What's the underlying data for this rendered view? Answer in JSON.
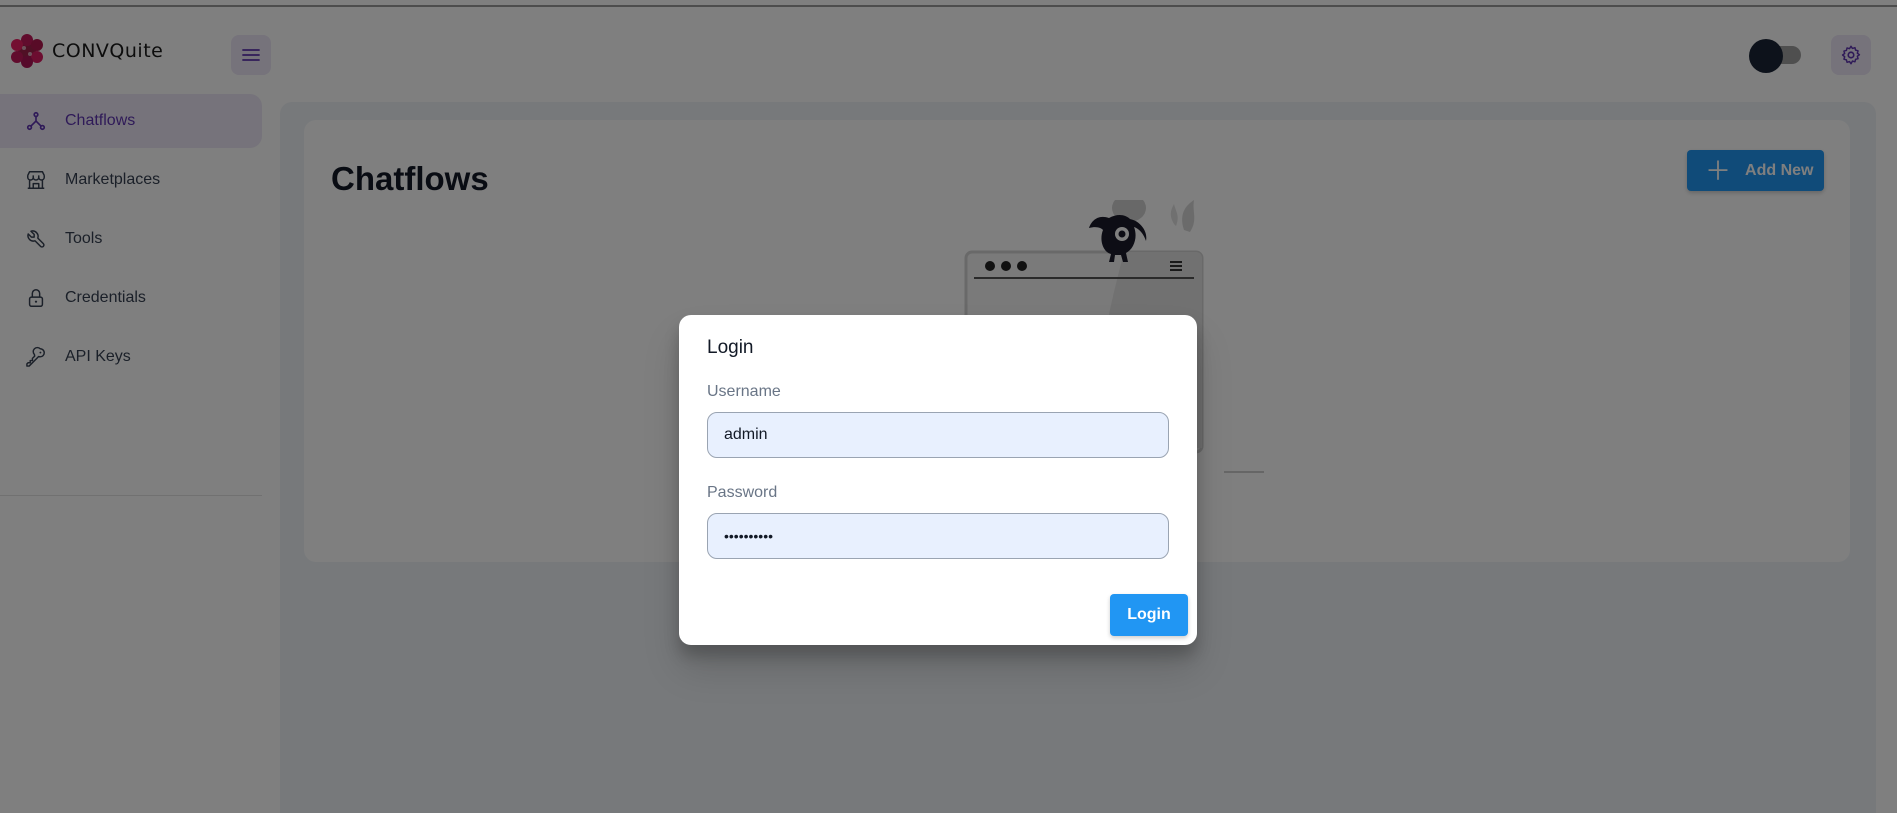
{
  "app": {
    "logo_text": "CONVQuite"
  },
  "sidebar": {
    "items": [
      {
        "label": "Chatflows",
        "icon": "hierarchy-icon",
        "active": true
      },
      {
        "label": "Marketplaces",
        "icon": "building-store-icon",
        "active": false
      },
      {
        "label": "Tools",
        "icon": "tool-icon",
        "active": false
      },
      {
        "label": "Credentials",
        "icon": "lock-icon",
        "active": false
      },
      {
        "label": "API Keys",
        "icon": "key-icon",
        "active": false
      }
    ]
  },
  "main": {
    "title": "Chatflows",
    "add_button_label": "Add New"
  },
  "dialog": {
    "title": "Login",
    "username_label": "Username",
    "username_value": "admin",
    "password_label": "Password",
    "password_value": "••••••••••",
    "submit_label": "Login"
  },
  "colors": {
    "accent": "#2196f3",
    "primary_purple": "#5e35b1",
    "nav_active_bg": "#ede7f6",
    "main_bg": "#eef2f6",
    "input_bg": "#e8f0fe"
  }
}
